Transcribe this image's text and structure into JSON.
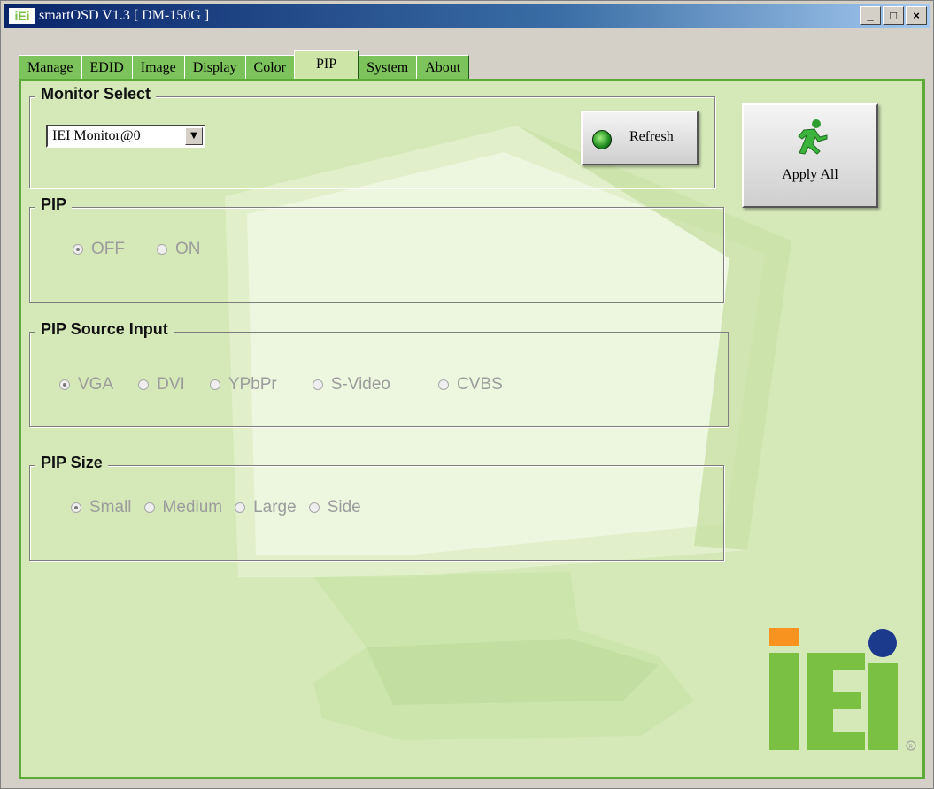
{
  "window": {
    "title": "smartOSD V1.3 [ DM-150G ]",
    "app_icon": "iEi",
    "controls": {
      "minimize": "_",
      "maximize": "□",
      "close": "×"
    }
  },
  "tabs": [
    {
      "label": "Manage"
    },
    {
      "label": "EDID"
    },
    {
      "label": "Image"
    },
    {
      "label": "Display"
    },
    {
      "label": "Color"
    },
    {
      "label": "PIP"
    },
    {
      "label": "System"
    },
    {
      "label": "About"
    }
  ],
  "active_tab": "PIP",
  "monitor_select": {
    "label": "Monitor Select",
    "selected": "IEI Monitor@0",
    "refresh_label": "Refresh"
  },
  "apply_all": {
    "label": "Apply All",
    "icon": "running-man-icon"
  },
  "pip": {
    "label": "PIP",
    "options": [
      {
        "label": "OFF",
        "selected": true
      },
      {
        "label": "ON",
        "selected": false
      }
    ]
  },
  "pip_source": {
    "label": "PIP Source Input",
    "options": [
      {
        "label": "VGA",
        "selected": true
      },
      {
        "label": "DVI",
        "selected": false
      },
      {
        "label": "YPbPr",
        "selected": false
      },
      {
        "label": "S-Video",
        "selected": false
      },
      {
        "label": "CVBS",
        "selected": false
      }
    ]
  },
  "pip_size": {
    "label": "PIP Size",
    "options": [
      {
        "label": "Small",
        "selected": true
      },
      {
        "label": "Medium",
        "selected": false
      },
      {
        "label": "Large",
        "selected": false
      },
      {
        "label": "Side",
        "selected": false
      }
    ]
  },
  "logo": {
    "text": "iEi",
    "registered": "®"
  },
  "colors": {
    "panel_bg": "#d5e9b8",
    "tab_bg": "#7dc35b",
    "border_green": "#5caa38",
    "logo_green": "#7ac143",
    "logo_orange": "#f7931e",
    "logo_blue": "#1b3a8c"
  }
}
